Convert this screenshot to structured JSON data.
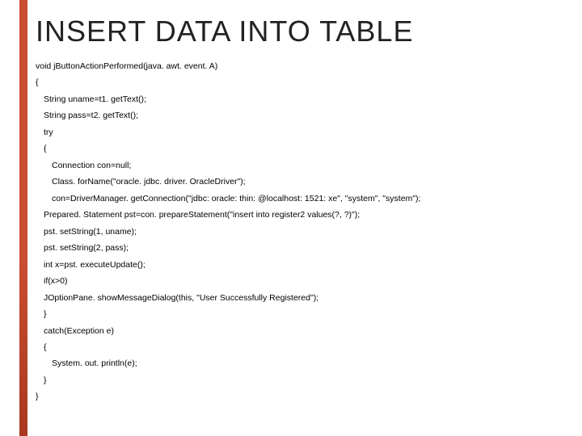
{
  "title": "INSERT DATA INTO TABLE",
  "code": {
    "l1": "void jButtonActionPerformed(java. awt. event. A)",
    "l2": "{",
    "l3": "String uname=t1. getText();",
    "l4": "String pass=t2. getText();",
    "l5": "try",
    "l6": "{",
    "l7": "Connection con=null;",
    "l8": "Class. forName(\"oracle. jdbc. driver. OracleDriver\");",
    "l9": "con=DriverManager. getConnection(\"jdbc: oracle: thin: @localhost: 1521: xe\", \"system\", \"system\");",
    "l10": "Prepared. Statement pst=con. prepareStatement(\"insert into register2 values(?, ?)\");",
    "l11": "pst. setString(1, uname);",
    "l12": "pst. setString(2, pass);",
    "l13": "int x=pst. executeUpdate();",
    "l14": "if(x>0)",
    "l15": "JOptionPane. showMessageDialog(this, \"User Successfully Registered\");",
    "l16": "}",
    "l17": "catch(Exception e)",
    "l18": "{",
    "l19": "System. out. println(e);",
    "l20": "}",
    "l21": "}"
  }
}
